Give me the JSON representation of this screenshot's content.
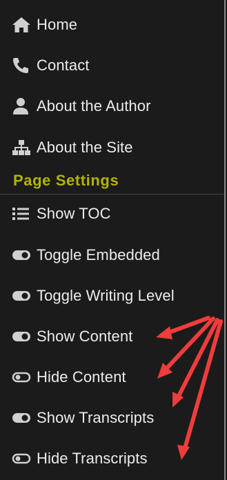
{
  "nav": {
    "items": [
      {
        "label": "Home",
        "icon": "home-icon"
      },
      {
        "label": "Contact",
        "icon": "phone-icon"
      },
      {
        "label": "About the Author",
        "icon": "user-icon"
      },
      {
        "label": "About the Site",
        "icon": "sitemap-icon"
      }
    ]
  },
  "settings": {
    "title": "Page Settings",
    "items": [
      {
        "label": "Show TOC",
        "icon": "list-icon"
      },
      {
        "label": "Toggle Embedded",
        "icon": "toggle-on-icon"
      },
      {
        "label": "Toggle Writing Level",
        "icon": "toggle-on-icon"
      },
      {
        "label": "Show Content",
        "icon": "toggle-on-icon"
      },
      {
        "label": "Hide Content",
        "icon": "toggle-off-icon"
      },
      {
        "label": "Show Transcripts",
        "icon": "toggle-on-icon"
      },
      {
        "label": "Hide Transcripts",
        "icon": "toggle-off-icon"
      }
    ]
  },
  "colors": {
    "background": "#1b1b1b",
    "text": "#ececec",
    "icon": "#d0d0d0",
    "section_title": "#b3b300",
    "annotation_arrow": "#f03c3c"
  }
}
